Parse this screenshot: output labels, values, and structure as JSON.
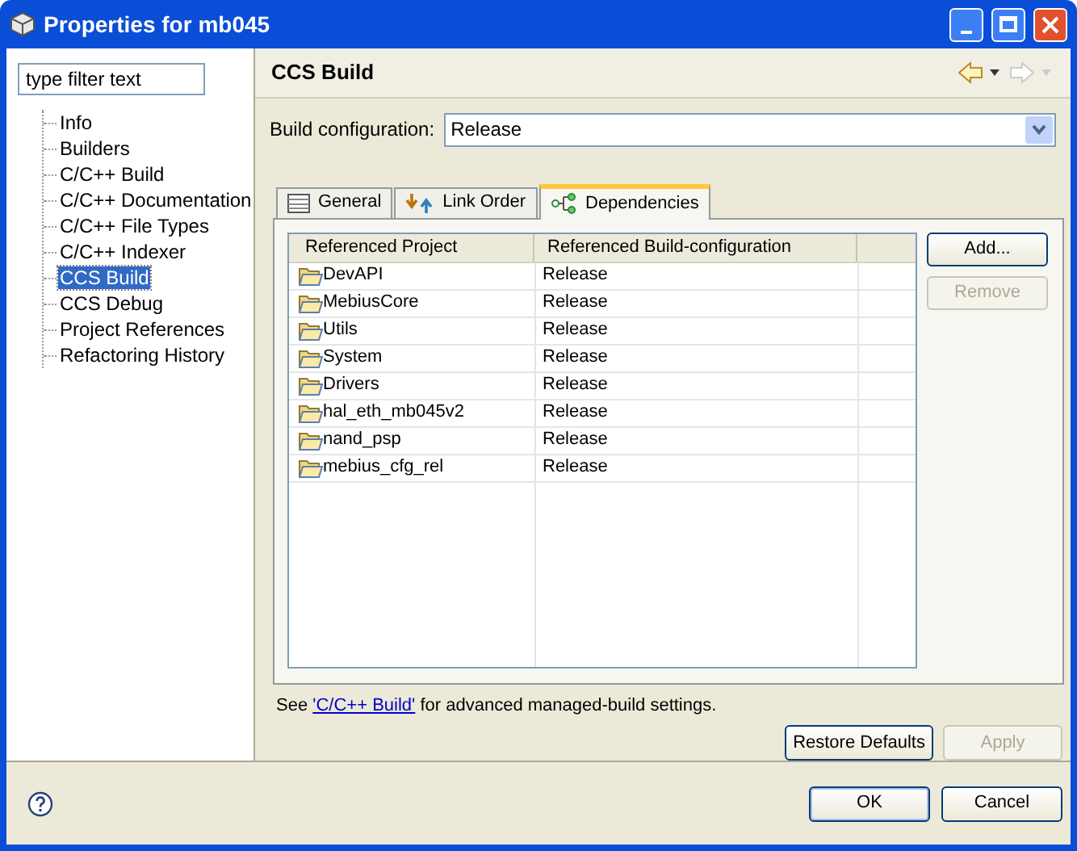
{
  "window": {
    "title": "Properties for mb045"
  },
  "filter": {
    "placeholder": "type filter text"
  },
  "tree": [
    {
      "label": "Info",
      "selected": false
    },
    {
      "label": "Builders",
      "selected": false
    },
    {
      "label": "C/C++ Build",
      "selected": false
    },
    {
      "label": "C/C++ Documentation",
      "selected": false
    },
    {
      "label": "C/C++ File Types",
      "selected": false
    },
    {
      "label": "C/C++ Indexer",
      "selected": false
    },
    {
      "label": "CCS Build",
      "selected": true
    },
    {
      "label": "CCS Debug",
      "selected": false
    },
    {
      "label": "Project References",
      "selected": false
    },
    {
      "label": "Refactoring History",
      "selected": false
    }
  ],
  "page": {
    "title": "CCS Build",
    "back_enabled": true,
    "forward_enabled": false
  },
  "build_configuration": {
    "label": "Build configuration:",
    "value": "Release"
  },
  "tabs": [
    {
      "label": "General",
      "kind": "general",
      "selected": false
    },
    {
      "label": "Link Order",
      "kind": "link",
      "selected": false
    },
    {
      "label": "Dependencies",
      "kind": "deps",
      "selected": true
    }
  ],
  "table": {
    "columns": [
      "Referenced Project",
      "Referenced Build-configuration"
    ],
    "rows": [
      [
        "DevAPI",
        "Release"
      ],
      [
        "MebiusCore",
        "Release"
      ],
      [
        "Utils",
        "Release"
      ],
      [
        "System",
        "Release"
      ],
      [
        "Drivers",
        "Release"
      ],
      [
        "hal_eth_mb045v2",
        "Release"
      ],
      [
        "nand_psp",
        "Release"
      ],
      [
        "mebius_cfg_rel",
        "Release"
      ]
    ]
  },
  "side_buttons": [
    {
      "label": "Add...",
      "disabled": false
    },
    {
      "label": "Remove",
      "disabled": true
    }
  ],
  "note": {
    "before": "See ",
    "link": "'C/C++ Build'",
    "after": " for advanced managed-build settings."
  },
  "page_buttons": [
    {
      "label": "Restore Defaults",
      "disabled": false
    },
    {
      "label": "Apply",
      "disabled": true
    }
  ],
  "dialog_buttons": [
    {
      "label": "OK",
      "default": true
    },
    {
      "label": "Cancel",
      "default": false
    }
  ]
}
